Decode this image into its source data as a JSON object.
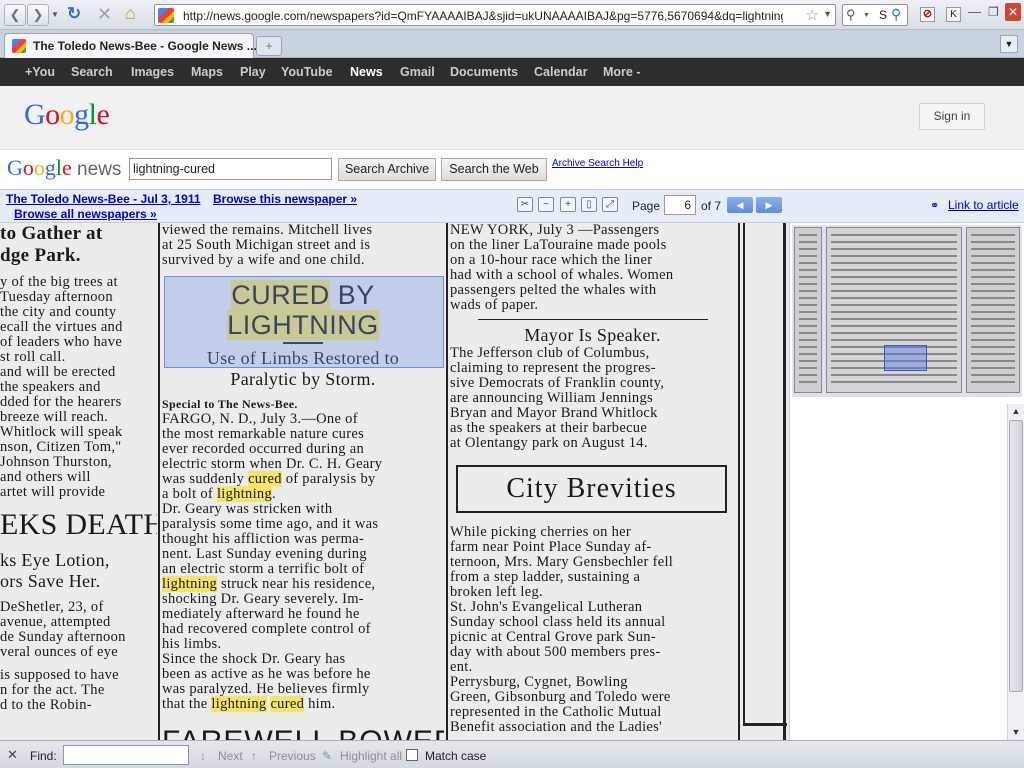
{
  "browser": {
    "url": "http://news.google.com/newspapers?id=QmFYAAAAIBAJ&sjid=ukUNAAAAIBAJ&pg=5776,5670694&dq=lightning-cured&hl=e",
    "tab_title": "The Toledo News-Bee - Google News ...",
    "search_text": "S"
  },
  "gbar": {
    "items": [
      "+You",
      "Search",
      "Images",
      "Maps",
      "Play",
      "YouTube",
      "News",
      "Gmail",
      "Documents",
      "Calendar",
      "More -"
    ],
    "selected": "News"
  },
  "header": {
    "logo": "Google",
    "sign_in": "Sign in"
  },
  "search": {
    "logo_google": "Google",
    "logo_news": "news",
    "query": "lightning-cured",
    "archive_button": "Search Archive",
    "web_button": "Search the Web",
    "help_link": "Archive Search Help"
  },
  "viewer": {
    "paper_link": "The Toledo News-Bee - Jul 3, 1911",
    "browse_paper": "Browse this newspaper »",
    "browse_all": "Browse all newspapers »",
    "page_label": "Page",
    "page_value": "6",
    "page_of": "of 7",
    "link_article": "Link to article",
    "icons": [
      "clip-icon",
      "zoom-out-icon",
      "zoom-in-icon",
      "fit-width-icon",
      "fullscreen-icon"
    ]
  },
  "article": {
    "col1": [
      "to Gather at",
      "dge Park.",
      "",
      "y of the big trees at",
      "Tuesday afternoon",
      "the city and county",
      "ecall the virtues and",
      "of leaders who have",
      "st roll call.",
      "and will be erected",
      "the speakers and",
      "dded for the hearers",
      "breeze will reach.",
      "Whitlock will speak",
      "nson, Citizen Tom,\"",
      "Johnson Thurston,",
      "and others will",
      "artet will provide",
      "",
      "EKS DEATH",
      "",
      "ks Eye Lotion,",
      "ors Save Her.",
      "",
      "DeShetler, 23, of",
      "avenue, attempted",
      "de Sunday afternoon",
      "veral ounces of eye",
      "",
      "is supposed to have",
      "n for the act. The",
      "d to the Robin-"
    ],
    "col2_top": [
      "viewed the remains. Mitchell lives",
      "at 25 South Michigan street and is",
      "survived by a wife and one child."
    ],
    "headline": "CURED BY LIGHTNING",
    "subhead1": "Use of Limbs Restored to",
    "subhead2": "Paralytic by Storm.",
    "special": "Special to The News-Bee.",
    "col2_body": [
      "FARGO, N. D., July 3.—One of",
      "the most remarkable nature cures",
      "ever recorded occurred during an",
      "electric storm when Dr. C. H. Geary",
      "was suddenly cured of paralysis by",
      "a bolt of lightning.",
      "Dr. Geary was stricken with",
      "paralysis some time ago, and it was",
      "thought his affliction was perma-",
      "nent. Last Sunday evening during",
      "an electric storm a terrific bolt of",
      "lightning struck near his residence,",
      "shocking Dr. Geary severely. Im-",
      "mediately afterward he found he",
      "had recovered complete control of",
      "his limbs.",
      "Since the shock Dr. Geary has",
      "been as active as he was before he",
      "was paralyzed. He believes firmly",
      "that the lightning cured him."
    ],
    "col2_bottom": "FAREWELL BOWERY",
    "col3_top": [
      "NEW YORK, July 3 —Passengers",
      "on the liner LaTouraine made pools",
      "on a 10-hour race which the liner",
      "had with a school of whales. Women",
      "passengers pelted the whales with",
      "wads of paper."
    ],
    "col3_head": "Mayor Is Speaker.",
    "col3_mid": [
      "The Jefferson club of Columbus,",
      "claiming to represent the progres-",
      "sive Democrats of Franklin county,",
      "are announcing William Jennings",
      "Bryan and Mayor Brand Whitlock",
      "as the speakers at their barbecue",
      "at Olentangy park on August 14."
    ],
    "col3_box": "City Brevities",
    "col3_bottom": [
      "While picking cherries on her",
      "farm near Point Place Sunday af-",
      "ternoon, Mrs. Mary Gensbechler fell",
      "from a step ladder, sustaining a",
      "broken left leg.",
      "St. John's Evangelical Lutheran",
      "Sunday school class held its annual",
      "picnic at Central Grove park Sun-",
      "day with about 500 members pres-",
      "ent.",
      "Perrysburg, Cygnet, Bowling",
      "Green, Gibsonburg and Toledo were",
      "represented in the Catholic Mutual",
      "Benefit association and the Ladies'"
    ]
  },
  "findbar": {
    "close": "✕",
    "find_label": "Find:",
    "next": "Next",
    "previous": "Previous",
    "highlight": "Highlight all",
    "match_case": "Match case"
  }
}
